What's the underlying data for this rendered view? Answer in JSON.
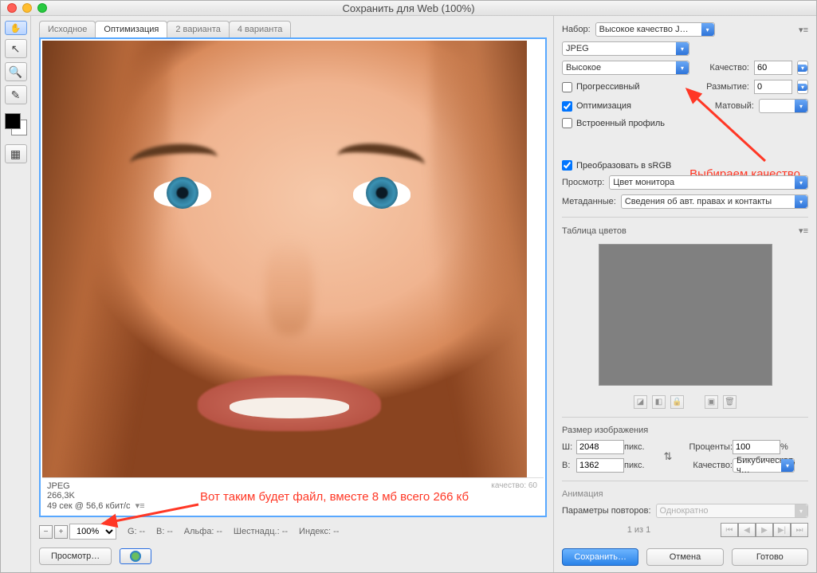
{
  "title": "Сохранить для Web (100%)",
  "tabs": [
    "Исходное",
    "Оптимизация",
    "2 варианта",
    "4 варианта"
  ],
  "active_tab": 1,
  "info": {
    "format": "JPEG",
    "size": "266,3K",
    "time": "49 сек @ 56,6 кбит/с",
    "quality_readout": "качество: 60"
  },
  "annotations": {
    "quality_note": "Выбираем качество",
    "file_note": "Вот таким будет файл, вместе 8 мб всего 266 кб"
  },
  "status": {
    "zoom": "100%",
    "g": "G: --",
    "b": "B: --",
    "alpha": "Альфа: --",
    "hex": "Шестнадц.: --",
    "index": "Индекс: --"
  },
  "footer": {
    "preview": "Просмотр…",
    "save": "Сохранить…",
    "cancel": "Отмена",
    "done": "Готово"
  },
  "side": {
    "preset_label": "Набор:",
    "preset": "Высокое качество J…",
    "format": "JPEG",
    "quality_preset": "Высокое",
    "quality_label": "Качество:",
    "quality": "60",
    "blur_label": "Размытие:",
    "blur": "0",
    "matte_label": "Матовый:",
    "progressive": "Прогрессивный",
    "optimized": "Оптимизация",
    "embed_profile": "Встроенный профиль",
    "srgb": "Преобразовать в sRGB",
    "preview_label": "Просмотр:",
    "preview_value": "Цвет монитора",
    "metadata_label": "Метаданные:",
    "metadata_value": "Сведения об авт. правах и контакты",
    "color_table": "Таблица цветов",
    "image_size": "Размер изображения",
    "w_label": "Ш:",
    "w": "2048",
    "h_label": "В:",
    "h": "1362",
    "px": "пикс.",
    "percent_label": "Проценты:",
    "percent": "100",
    "pct_sign": "%",
    "resample_label": "Качество:",
    "resample": "Бикубическая, ч…",
    "animation": "Анимация",
    "loop_label": "Параметры повторов:",
    "loop": "Однократно",
    "frame": "1 из 1"
  }
}
